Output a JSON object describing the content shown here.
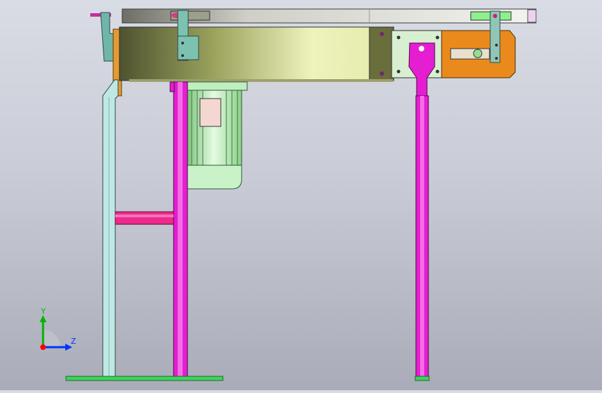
{
  "view": {
    "background_top": "#d9dce4",
    "background_bottom": "#a9acb8"
  },
  "model": {
    "colors": {
      "top_rail": "#e6e6e1",
      "belt_body_dark": "#5b5f32",
      "belt_body_light": "#e9efb3",
      "motor": "#c7f0c5",
      "motor_dark": "#86c886",
      "leg_magenta": "#e21fd0",
      "leg_cyan": "#bfe7e3",
      "bracket": "#6fb0a3",
      "drive_orange": "#e98a1b",
      "plate": "#d9efd2",
      "base_green": "#3fd35a",
      "crossbar_pink": "#ee2b8d"
    }
  },
  "triad": {
    "y_label": "Y",
    "z_label": "Z",
    "y_color": "#00b400",
    "z_color": "#0033ff",
    "origin_color": "#ff0000"
  }
}
